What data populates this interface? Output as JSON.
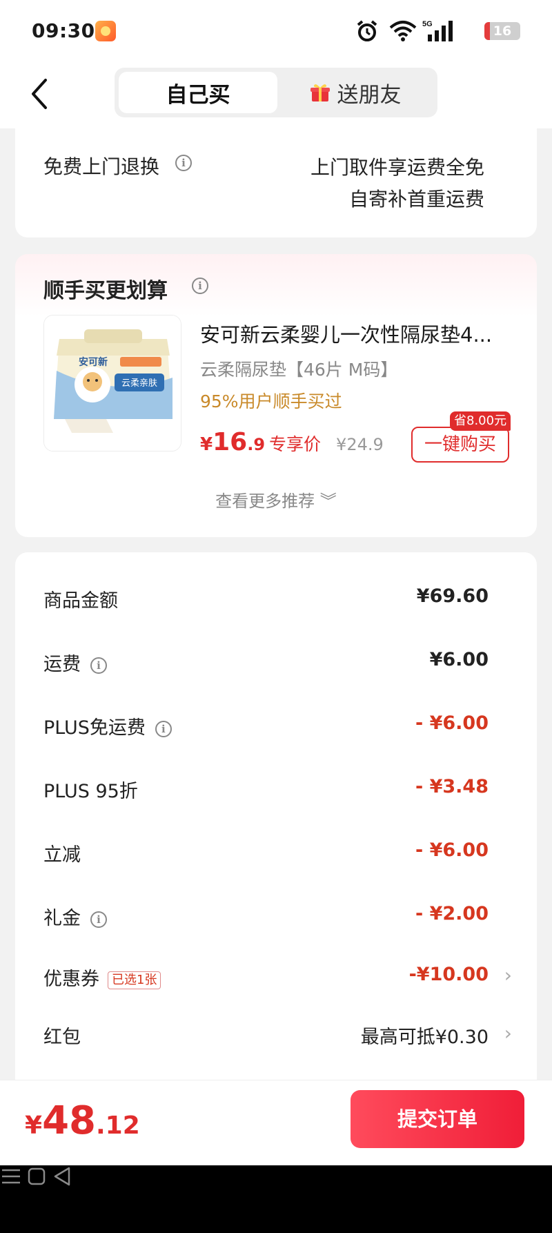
{
  "status_bar": {
    "time": "09:30",
    "battery": "16",
    "battery_level": 0.16,
    "network": "5G"
  },
  "header": {
    "tabs": [
      "自己买",
      "送朋友"
    ],
    "active_tab": "自己买"
  },
  "return_section": {
    "label": "免费上门退换",
    "line1": "上门取件享运费全免",
    "line2": "自寄补首重运费"
  },
  "bundle": {
    "title": "顺手买更划算",
    "product_name": "安可新云柔婴儿一次性隔尿垫4...",
    "spec": "云柔隔尿垫【46片 M码】",
    "social_proof": "95%用户顺手买过",
    "price_yen": "¥",
    "price_int": "16",
    "price_dec": ".9",
    "price_label": "专享价",
    "original_price": "¥24.9",
    "save_badge": "省8.00元",
    "buy_button": "一键购买",
    "more": "查看更多推荐 ︾"
  },
  "product_image": {
    "brand": "安可新",
    "series": "云柔亲肤"
  },
  "summary": {
    "rows": [
      {
        "label": "商品金额",
        "value": "¥69.60"
      },
      {
        "label": "运费",
        "value": "¥6.00"
      },
      {
        "label": "PLUS免运费",
        "value": "- ¥6.00"
      },
      {
        "label": "PLUS 95折",
        "value": "- ¥3.48"
      },
      {
        "label": "立减",
        "value": "- ¥6.00"
      },
      {
        "label": "礼金",
        "value": "- ¥2.00"
      },
      {
        "label": "优惠券",
        "value": "-¥10.00",
        "badge": "已选1张"
      },
      {
        "label": "红包",
        "value": "最高可抵¥0.30"
      }
    ]
  },
  "footer": {
    "total_yen": "¥",
    "total_int": "48",
    "total_dec": ".12",
    "submit": "提交订单"
  },
  "colors": {
    "accent": "#e02c2c",
    "discount": "#d6371f",
    "submit": "#f01e38"
  }
}
